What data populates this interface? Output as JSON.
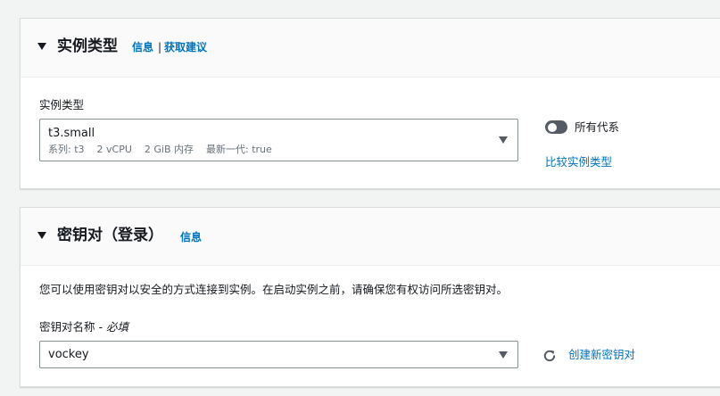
{
  "instance_type_section": {
    "title": "实例类型",
    "info_link": "信息",
    "separator": "|",
    "recommend_link": "获取建议",
    "field_label": "实例类型",
    "selected": {
      "value": "t3.small",
      "family": "系列: t3",
      "vcpu": "2 vCPU",
      "memory": "2 GiB 内存",
      "latest_gen": "最新一代: true"
    },
    "toggle_label": "所有代系",
    "toggle_on": false,
    "compare_link": "比较实例类型"
  },
  "key_pair_section": {
    "title": "密钥对（登录）",
    "info_link": "信息",
    "description": "您可以使用密钥对以安全的方式连接到实例。在启动实例之前，请确保您有权访问所选密钥对。",
    "field_label": "密钥对名称",
    "field_label_sep": " - ",
    "required_label": "必填",
    "selected": "vockey",
    "refresh_icon": "refresh-icon",
    "create_link": "创建新密钥对"
  },
  "colors": {
    "link": "#0073bb",
    "text": "#16191f",
    "muted": "#687078",
    "background": "#f2f3f3"
  }
}
